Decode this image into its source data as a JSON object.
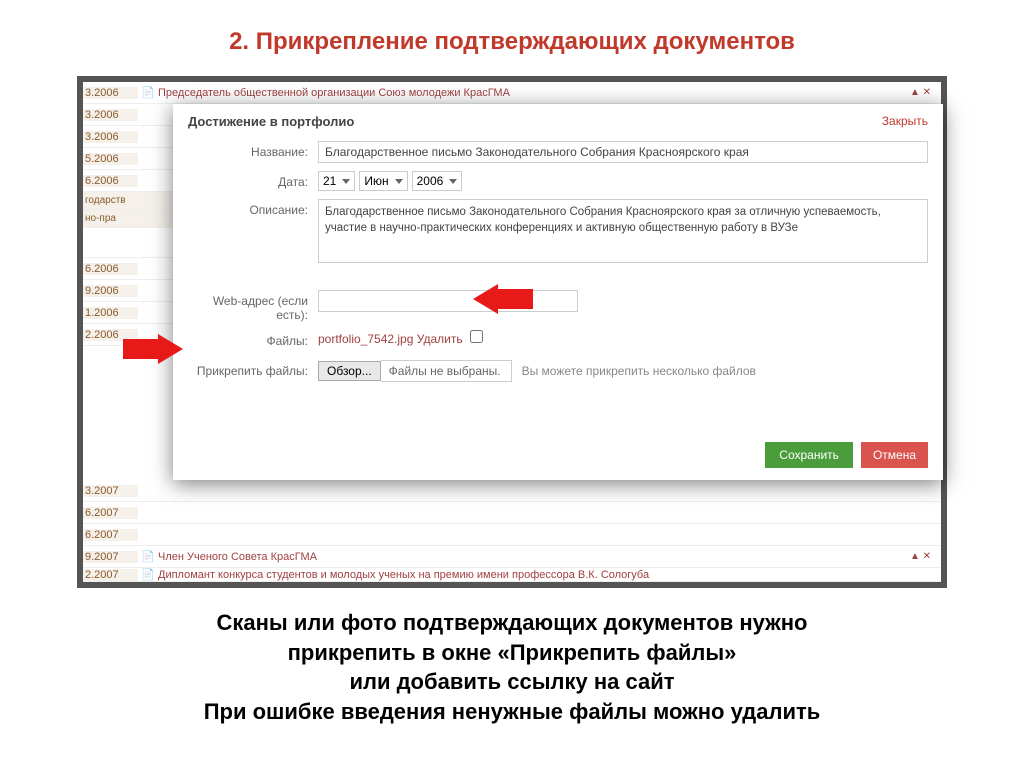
{
  "slide": {
    "title": "2. Прикрепление подтверждающих документов"
  },
  "bg_rows_top": [
    {
      "date": "3.2006",
      "text": "Председатель общественной организации Союз молодежи КрасГМА",
      "marks": "▲ ✕"
    },
    {
      "date": "3.2006"
    },
    {
      "date": "3.2006"
    },
    {
      "date": "5.2006"
    },
    {
      "date": "6.2006"
    }
  ],
  "bg_truncated_1": "годарств",
  "bg_truncated_2": "но-пра",
  "bg_rows_mid": [
    {
      "date": "6.2006"
    },
    {
      "date": "9.2006"
    },
    {
      "date": "1.2006"
    },
    {
      "date": "2.2006"
    }
  ],
  "bg_rows_bottom": [
    {
      "date": "3.2007"
    },
    {
      "date": "6.2007"
    },
    {
      "date": "6.2007"
    },
    {
      "date": "9.2007",
      "text": "Член Ученого Совета КрасГМА",
      "marks": "▲ ✕"
    },
    {
      "date": "2.2007",
      "text": "Дипломант конкурса студентов и молодых ученых на премию имени профессора В.К. Сологуба"
    }
  ],
  "dialog": {
    "title": "Достижение в портфолио",
    "close": "Закрыть",
    "name_label": "Название:",
    "name_value": "Благодарственное письмо Законодательного Собрания Красноярского края",
    "date_label": "Дата:",
    "date_day": "21",
    "date_month": "Июн",
    "date_year": "2006",
    "desc_label": "Описание:",
    "desc_value": "Благодарственное письмо Законодательного Собрания Красноярского края за отличную успеваемость, участие в научно-практических конференциях и активную общественную работу в ВУЗе",
    "web_label": "Web-адрес (если есть):",
    "files_label": "Файлы:",
    "file_name": "portfolio_7542.jpg",
    "file_delete": "Удалить",
    "attach_label": "Прикрепить файлы:",
    "browse": "Обзор...",
    "no_files": "Файлы не выбраны.",
    "attach_hint": "Вы можете прикрепить несколько файлов",
    "save": "Сохранить",
    "cancel": "Отмена"
  },
  "caption": {
    "line1": "Сканы или фото подтверждающих документов нужно",
    "line2": "прикрепить в окне «Прикрепить файлы»",
    "line3": "или добавить ссылку на сайт",
    "line4": "При ошибке введения ненужные файлы можно удалить"
  }
}
